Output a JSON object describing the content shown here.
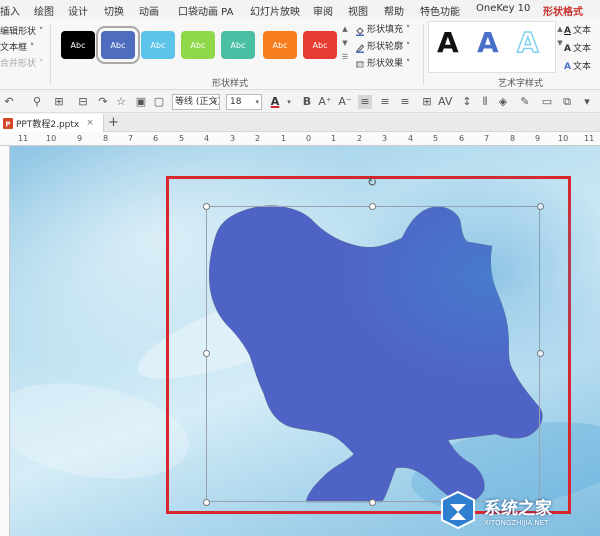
{
  "menu": {
    "tabs": [
      {
        "label": "插入"
      },
      {
        "label": "绘图"
      },
      {
        "label": "设计"
      },
      {
        "label": "切换"
      },
      {
        "label": "动画"
      },
      {
        "label": "口袋动画 PA"
      },
      {
        "label": "幻灯片放映"
      },
      {
        "label": "审阅"
      },
      {
        "label": "视图"
      },
      {
        "label": "帮助"
      },
      {
        "label": "特色功能"
      },
      {
        "label": "OneKey 10"
      },
      {
        "label": "形状格式"
      }
    ],
    "active_tab": "形状格式"
  },
  "ribbon": {
    "left_commands": [
      {
        "label": "编辑形状 ˅"
      },
      {
        "label": "文本框 ˅"
      },
      {
        "label": "合并形状 ˅"
      }
    ],
    "shape_styles": {
      "group_label": "形状样式",
      "swatches": [
        {
          "text": "Abc",
          "color": "#000000"
        },
        {
          "text": "Abc",
          "color": "#4f6dbf"
        },
        {
          "text": "Abc",
          "color": "#5bc4e8"
        },
        {
          "text": "Abc",
          "color": "#8ed84a"
        },
        {
          "text": "Abc",
          "color": "#4bbfa4"
        },
        {
          "text": "Abc",
          "color": "#f57d1e"
        },
        {
          "text": "Abc",
          "color": "#e53b30"
        }
      ],
      "commands": [
        {
          "label": "形状填充 ˅"
        },
        {
          "label": "形状轮廓 ˅"
        },
        {
          "label": "形状效果 ˅"
        }
      ]
    },
    "word_art": {
      "group_label": "艺术字样式",
      "letters": [
        {
          "text": "A",
          "color": "#111111"
        },
        {
          "text": "A",
          "color": "#4a6fc9"
        },
        {
          "text": "A",
          "color": "#7fd3ea"
        }
      ],
      "commands": [
        {
          "label": "文本"
        },
        {
          "label": "文本"
        },
        {
          "label": "文本"
        }
      ]
    }
  },
  "toolbar": {
    "font_name": "等线 (正文)",
    "font_size": "18",
    "font_color": "#d8262e"
  },
  "document": {
    "tab_label": "PPT教程2.pptx",
    "close_glyph": "×",
    "add_glyph": "+"
  },
  "ruler": {
    "numbers": [
      "11",
      "10",
      "9",
      "8",
      "7",
      "6",
      "5",
      "4",
      "3",
      "2",
      "1",
      "0",
      "1",
      "2",
      "3",
      "4",
      "5",
      "6",
      "7",
      "8",
      "9",
      "10",
      "11"
    ]
  },
  "watermark": {
    "title": "系统之家",
    "subtitle": "XITONGZHIJIA.NET"
  },
  "colors": {
    "accent": "#c9302c",
    "shape_fill": "#4f63c7",
    "frame_red": "#d8262e"
  }
}
